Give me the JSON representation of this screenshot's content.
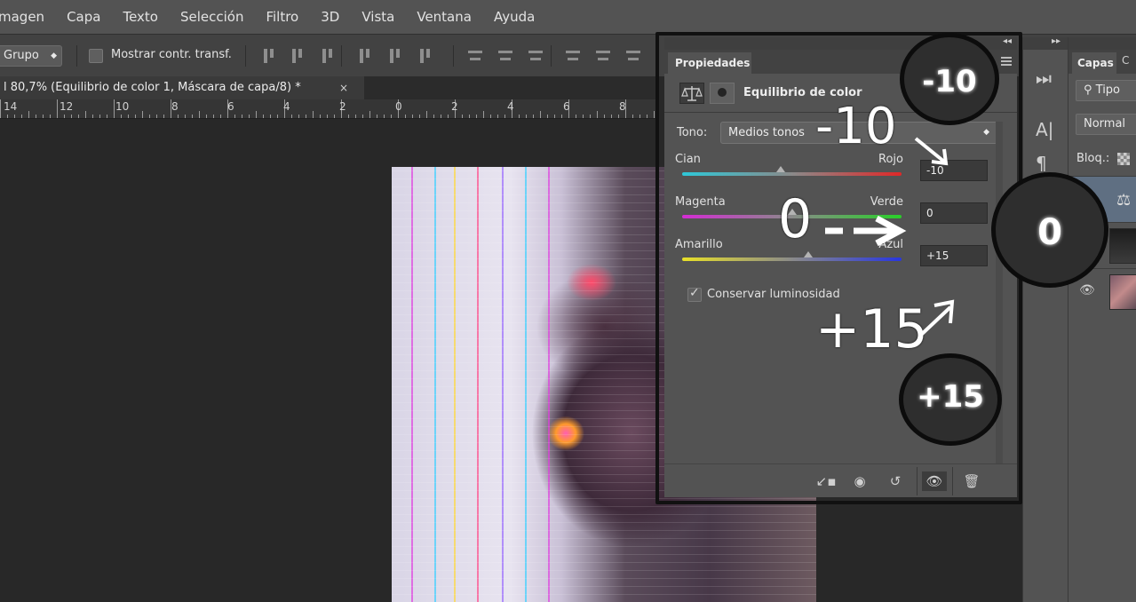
{
  "menu": [
    "magen",
    "Capa",
    "Texto",
    "Selección",
    "Filtro",
    "3D",
    "Vista",
    "Ventana",
    "Ayuda"
  ],
  "options": {
    "group_select": "Grupo",
    "show_transform": "Mostrar contr. transf."
  },
  "document": {
    "tab_title": "l 80,7% (Equilibrio de color 1, Máscara de capa/8) *",
    "close_glyph": "×"
  },
  "ruler": [
    "14",
    "12",
    "10",
    "8",
    "6",
    "4",
    "2",
    "0",
    "2",
    "4",
    "6",
    "8"
  ],
  "properties": {
    "tab_label": "Propiedades",
    "title": "Equilibrio de color",
    "tone_label": "Tono:",
    "tone_value": "Medios tonos",
    "sliders": [
      {
        "left": "Cian",
        "right": "Rojo",
        "value": "-10",
        "amount": -10,
        "left_color": "#2ec8d8",
        "right_color": "#e02828"
      },
      {
        "left": "Magenta",
        "right": "Verde",
        "value": "0",
        "amount": 0,
        "left_color": "#d42cd4",
        "right_color": "#28d028"
      },
      {
        "left": "Amarillo",
        "right": "Azul",
        "value": "+15",
        "amount": 15,
        "left_color": "#e8e028",
        "right_color": "#2836e0"
      }
    ],
    "preserve_luminosity": "Conservar luminosidad",
    "preserve_checked": true
  },
  "layers": {
    "tab_label": "Capas",
    "tab2": "C",
    "search": "Tipo",
    "blend": "Normal",
    "lock": "Bloq.:"
  },
  "annotations": {
    "label_1": "-10",
    "label_2": "0",
    "label_3": "+15",
    "bubble_1": "-10",
    "bubble_2": "0",
    "bubble_3": "+15"
  },
  "colors": {
    "ui_bg": "#535353",
    "canvas_bg": "#282828",
    "frame": "#111111"
  }
}
